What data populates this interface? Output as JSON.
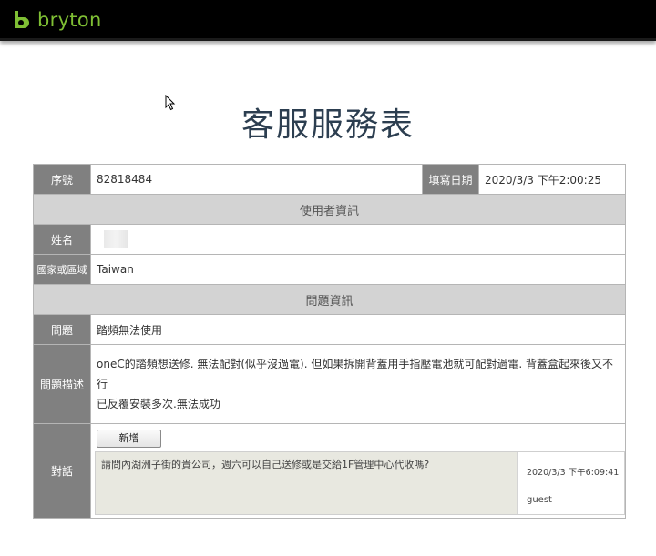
{
  "brand": {
    "name": "bryton",
    "color": "#7fbf34"
  },
  "page_title": "客服服務表",
  "form": {
    "serial_label": "序號",
    "serial_value": "82818484",
    "date_label": "填寫日期",
    "date_value": "2020/3/3 下午2:00:25",
    "user_section": "使用者資訊",
    "name_label": "姓名",
    "country_label": "國家或區域",
    "country_value": "Taiwan",
    "problem_section": "問題資訊",
    "problem_label": "問題",
    "problem_value": "踏頻無法使用",
    "desc_label": "問題描述",
    "desc_line1": "oneC的踏頻想送修. 無法配對(似乎沒過電). 但如果拆開背蓋用手指壓電池就可配對過電. 背蓋盒起來後又不行",
    "desc_line2": "已反覆安裝多次.無法成功",
    "dialog_label": "對話",
    "add_button": "新增",
    "messages": [
      {
        "text": "請問內湖洲子街的貴公司，週六可以自己送修或是交給1F管理中心代收嗎?",
        "time": "2020/3/3 下午6:09:41",
        "user": "guest"
      }
    ]
  },
  "colors": {
    "label_bg": "#808080",
    "section_bg": "#d3d3d3",
    "message_bg": "#e8e8e0",
    "title_color": "#2c3e50"
  },
  "icons": [
    "bryton-logo-icon",
    "mouse-pointer-icon"
  ]
}
